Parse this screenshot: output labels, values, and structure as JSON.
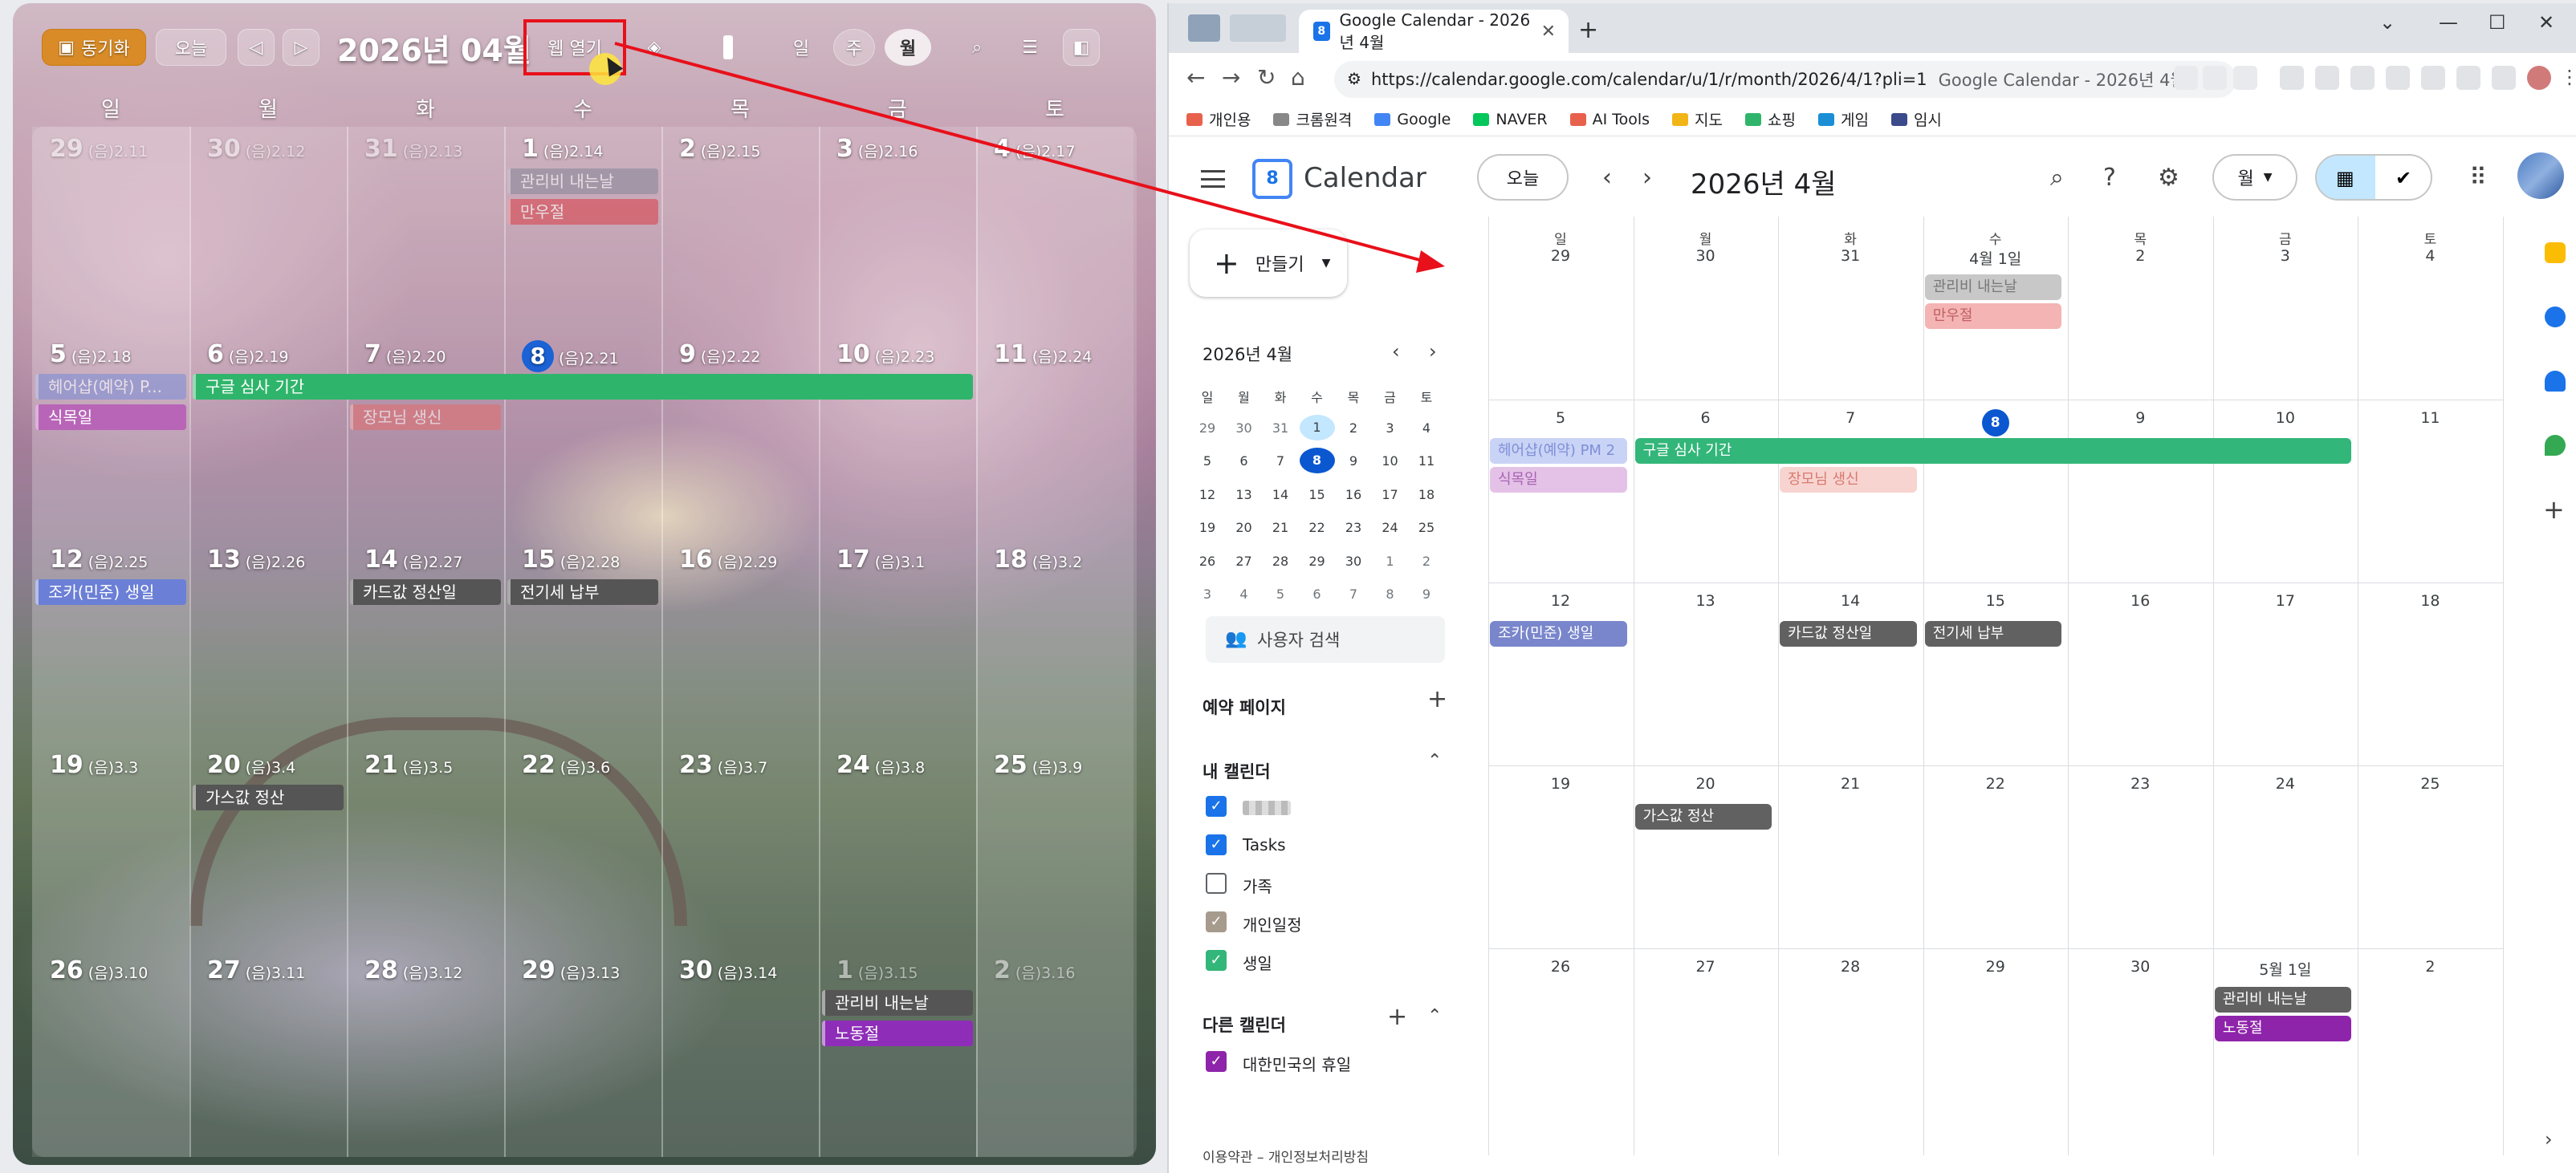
{
  "widget": {
    "sync_label": "동기화",
    "today_label": "오늘",
    "prev_icon": "◁",
    "next_icon": "▷",
    "title": "2026년 04월",
    "web_open_label": "웹 열기",
    "view_day": "일",
    "view_week": "주",
    "view_month": "월",
    "dow": [
      "일",
      "월",
      "화",
      "수",
      "목",
      "금",
      "토"
    ],
    "weeks": [
      [
        [
          "29",
          "(음)2.11"
        ],
        [
          "30",
          "(음)2.12"
        ],
        [
          "31",
          "(음)2.13"
        ],
        [
          "1",
          "(음)2.14"
        ],
        [
          "2",
          "(음)2.15"
        ],
        [
          "3",
          "(음)2.16"
        ],
        [
          "4",
          "(음)2.17"
        ]
      ],
      [
        [
          "5",
          "(음)2.18"
        ],
        [
          "6",
          "(음)2.19"
        ],
        [
          "7",
          "(음)2.20"
        ],
        [
          "8",
          "(음)2.21"
        ],
        [
          "9",
          "(음)2.22"
        ],
        [
          "10",
          "(음)2.23"
        ],
        [
          "11",
          "(음)2.24"
        ]
      ],
      [
        [
          "12",
          "(음)2.25"
        ],
        [
          "13",
          "(음)2.26"
        ],
        [
          "14",
          "(음)2.27"
        ],
        [
          "15",
          "(음)2.28"
        ],
        [
          "16",
          "(음)2.29"
        ],
        [
          "17",
          "(음)3.1"
        ],
        [
          "18",
          "(음)3.2"
        ]
      ],
      [
        [
          "19",
          "(음)3.3"
        ],
        [
          "20",
          "(음)3.4"
        ],
        [
          "21",
          "(음)3.5"
        ],
        [
          "22",
          "(음)3.6"
        ],
        [
          "23",
          "(음)3.7"
        ],
        [
          "24",
          "(음)3.8"
        ],
        [
          "25",
          "(음)3.9"
        ]
      ],
      [
        [
          "26",
          "(음)3.10"
        ],
        [
          "27",
          "(음)3.11"
        ],
        [
          "28",
          "(음)3.12"
        ],
        [
          "29",
          "(음)3.13"
        ],
        [
          "30",
          "(음)3.14"
        ],
        [
          "1",
          "(음)3.15"
        ],
        [
          "2",
          "(음)3.16"
        ]
      ]
    ],
    "events": [
      {
        "text": "관리비 내는날",
        "week": 0,
        "col": 3,
        "span": 1,
        "row": 0,
        "color": "#8a8a9a",
        "fade": true
      },
      {
        "text": "만우절",
        "week": 0,
        "col": 3,
        "span": 1,
        "row": 1,
        "color": "#d9464f",
        "fade": true
      },
      {
        "text": "헤어샵(예약) P...",
        "week": 1,
        "col": 0,
        "span": 1,
        "row": 0,
        "color": "#7f8fd6",
        "fade": true
      },
      {
        "text": "구글 심사 기간",
        "week": 1,
        "col": 1,
        "span": 5,
        "row": 0,
        "color": "#2fb56b",
        "fade": false
      },
      {
        "text": "식목일",
        "week": 1,
        "col": 0,
        "span": 1,
        "row": 1,
        "color": "#b865b8",
        "fade": false
      },
      {
        "text": "장모님 생신",
        "week": 1,
        "col": 2,
        "span": 1,
        "row": 1,
        "color": "#e07070",
        "fade": true
      },
      {
        "text": "조카(민준) 생일",
        "week": 2,
        "col": 0,
        "span": 1,
        "row": 0,
        "color": "#6b7fd6",
        "fade": false
      },
      {
        "text": "카드값 정산일",
        "week": 2,
        "col": 2,
        "span": 1,
        "row": 0,
        "color": "#555555",
        "fade": false
      },
      {
        "text": "전기세 납부",
        "week": 2,
        "col": 3,
        "span": 1,
        "row": 0,
        "color": "#555555",
        "fade": false
      },
      {
        "text": "가스값 정산",
        "week": 3,
        "col": 1,
        "span": 1,
        "row": 0,
        "color": "#555555",
        "fade": false
      },
      {
        "text": "관리비 내는날",
        "week": 4,
        "col": 5,
        "span": 1,
        "row": 0,
        "color": "#555555",
        "fade": false
      },
      {
        "text": "노동절",
        "week": 4,
        "col": 5,
        "span": 1,
        "row": 1,
        "color": "#8e2eb8",
        "fade": false
      }
    ]
  },
  "browser": {
    "tab_title": "Google Calendar - 2026년 4월",
    "tab_fav": "8",
    "url": "https://calendar.google.com/calendar/u/1/r/month/2026/4/1?pli=1",
    "url_title": "Google Calendar - 2026년 4월",
    "bookmarks": [
      {
        "label": "개인용",
        "color": "#e8614d"
      },
      {
        "label": "크롬원격",
        "color": "#888888"
      },
      {
        "label": "Google",
        "color": "#4285f4"
      },
      {
        "label": "NAVER",
        "color": "#03c75a"
      },
      {
        "label": "AI Tools",
        "color": "#e8614d"
      },
      {
        "label": "지도",
        "color": "#f2b516"
      },
      {
        "label": "쇼핑",
        "color": "#2fb56b"
      },
      {
        "label": "게임",
        "color": "#1a8fd6"
      },
      {
        "label": "임시",
        "color": "#3b4a8a"
      }
    ]
  },
  "gcal": {
    "app_name": "Calendar",
    "logo_num": "8",
    "today_label": "오늘",
    "title": "2026년 4월",
    "view_label": "월",
    "create_label": "만들기",
    "mini_title": "2026년 4월",
    "mini_dow": [
      "일",
      "월",
      "화",
      "수",
      "목",
      "금",
      "토"
    ],
    "mini_weeks": [
      [
        "29",
        "30",
        "31",
        "1",
        "2",
        "3",
        "4"
      ],
      [
        "5",
        "6",
        "7",
        "8",
        "9",
        "10",
        "11"
      ],
      [
        "12",
        "13",
        "14",
        "15",
        "16",
        "17",
        "18"
      ],
      [
        "19",
        "20",
        "21",
        "22",
        "23",
        "24",
        "25"
      ],
      [
        "26",
        "27",
        "28",
        "29",
        "30",
        "1",
        "2"
      ],
      [
        "3",
        "4",
        "5",
        "6",
        "7",
        "8",
        "9"
      ]
    ],
    "user_search": "사용자 검색",
    "booking": "예약 페이지",
    "my_cals": "내 캘린더",
    "cal_items": [
      {
        "label": "",
        "checked": true,
        "color": "#1a73e8",
        "blur": true
      },
      {
        "label": "Tasks",
        "checked": true,
        "color": "#1a73e8"
      },
      {
        "label": "가족",
        "checked": false,
        "color": "#5f6368"
      },
      {
        "label": "개인일정",
        "checked": true,
        "color": "#a79b8e"
      },
      {
        "label": "생일",
        "checked": true,
        "color": "#33b679"
      }
    ],
    "other_cals": "다른 캘린더",
    "other_items": [
      {
        "label": "대한민국의 휴일",
        "checked": true,
        "color": "#8e24aa"
      }
    ],
    "footer": "이용약관 – 개인정보처리방침",
    "dow": [
      "일",
      "월",
      "화",
      "수",
      "목",
      "금",
      "토"
    ],
    "weeks": [
      [
        "29",
        "30",
        "31",
        "4월 1일",
        "2",
        "3",
        "4"
      ],
      [
        "5",
        "6",
        "7",
        "8",
        "9",
        "10",
        "11"
      ],
      [
        "12",
        "13",
        "14",
        "15",
        "16",
        "17",
        "18"
      ],
      [
        "19",
        "20",
        "21",
        "22",
        "23",
        "24",
        "25"
      ],
      [
        "26",
        "27",
        "28",
        "29",
        "30",
        "5월 1일",
        "2"
      ]
    ],
    "events": [
      {
        "text": "관리비 내는날",
        "week": 0,
        "col": 3,
        "span": 1,
        "row": 0,
        "color": "#c8c8c8",
        "fg": "#777777"
      },
      {
        "text": "만우절",
        "week": 0,
        "col": 3,
        "span": 1,
        "row": 1,
        "color": "#f4b4b4",
        "fg": "#c06060"
      },
      {
        "text": "헤어샵(예약) PM 2",
        "week": 1,
        "col": 0,
        "span": 1,
        "row": 0,
        "color": "#c9d3f6",
        "fg": "#7f8fd6"
      },
      {
        "text": "구글 심사 기간",
        "week": 1,
        "col": 1,
        "span": 5,
        "row": 0,
        "color": "#33b679",
        "fg": "#ffffff"
      },
      {
        "text": "식목일",
        "week": 1,
        "col": 0,
        "span": 1,
        "row": 1,
        "color": "#e4c2e8",
        "fg": "#a763b0"
      },
      {
        "text": "장모님 생신",
        "week": 1,
        "col": 2,
        "span": 1,
        "row": 1,
        "color": "#f8d4d0",
        "fg": "#d77a70"
      },
      {
        "text": "조카(민준) 생일",
        "week": 2,
        "col": 0,
        "span": 1,
        "row": 0,
        "color": "#7986cb",
        "fg": "#ffffff"
      },
      {
        "text": "카드값 정산일",
        "week": 2,
        "col": 2,
        "span": 1,
        "row": 0,
        "color": "#616161",
        "fg": "#ffffff"
      },
      {
        "text": "전기세 납부",
        "week": 2,
        "col": 3,
        "span": 1,
        "row": 0,
        "color": "#616161",
        "fg": "#ffffff"
      },
      {
        "text": "가스값 정산",
        "week": 3,
        "col": 1,
        "span": 1,
        "row": 0,
        "color": "#616161",
        "fg": "#ffffff"
      },
      {
        "text": "관리비 내는날",
        "week": 4,
        "col": 5,
        "span": 1,
        "row": 0,
        "color": "#616161",
        "fg": "#ffffff"
      },
      {
        "text": "노동절",
        "week": 4,
        "col": 5,
        "span": 1,
        "row": 1,
        "color": "#8e24aa",
        "fg": "#ffffff"
      }
    ]
  }
}
